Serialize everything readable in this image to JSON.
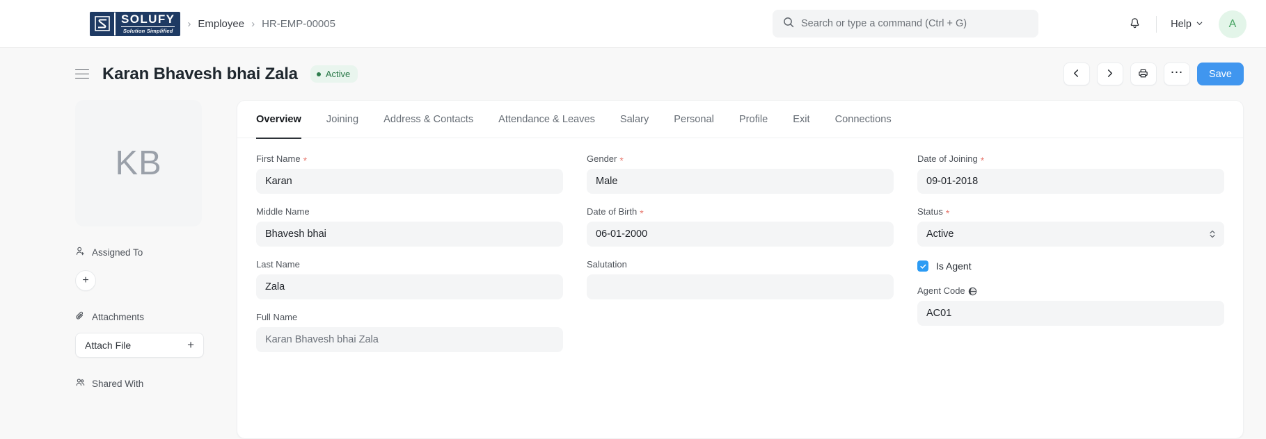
{
  "navbar": {
    "logo": {
      "word": "SOLUFY",
      "tagline": "Solution Simplified",
      "mark": "s-monogram-icon"
    },
    "breadcrumb": {
      "separator": "›",
      "parent": "Employee",
      "current": "HR-EMP-00005"
    },
    "search": {
      "placeholder": "Search or type a command (Ctrl + G)",
      "value": "",
      "icon": "search-icon"
    },
    "notifications_icon": "bell-icon",
    "help_label": "Help",
    "help_chevron": "chevron-down-icon",
    "avatar_initial": "A"
  },
  "title_row": {
    "menu_icon": "hamburger-icon",
    "title": "Karan Bhavesh bhai Zala",
    "status_badge": "Active",
    "actions": {
      "prev": "chevron-left-icon",
      "next": "chevron-right-icon",
      "print": "printer-icon",
      "more": "ellipsis-icon",
      "save_label": "Save"
    }
  },
  "sidebar": {
    "avatar_initials": "KB",
    "assigned_to": {
      "label": "Assigned To",
      "icon": "user-plus-icon",
      "add_label": "+"
    },
    "attachments": {
      "label": "Attachments",
      "icon": "paperclip-icon",
      "button_label": "Attach File",
      "button_icon": "plus-icon"
    },
    "shared_with": {
      "label": "Shared With",
      "icon": "users-icon"
    }
  },
  "tabs": [
    {
      "label": "Overview",
      "active": true
    },
    {
      "label": "Joining",
      "active": false
    },
    {
      "label": "Address & Contacts",
      "active": false
    },
    {
      "label": "Attendance & Leaves",
      "active": false
    },
    {
      "label": "Salary",
      "active": false
    },
    {
      "label": "Personal",
      "active": false
    },
    {
      "label": "Profile",
      "active": false
    },
    {
      "label": "Exit",
      "active": false
    },
    {
      "label": "Connections",
      "active": false
    }
  ],
  "form": {
    "col1": {
      "first_name": {
        "label": "First Name",
        "required": true,
        "value": "Karan"
      },
      "middle_name": {
        "label": "Middle Name",
        "required": false,
        "value": "Bhavesh bhai"
      },
      "last_name": {
        "label": "Last Name",
        "required": false,
        "value": "Zala"
      },
      "full_name": {
        "label": "Full Name",
        "required": false,
        "value": "Karan Bhavesh bhai Zala"
      }
    },
    "col2": {
      "gender": {
        "label": "Gender",
        "required": true,
        "value": "Male"
      },
      "dob": {
        "label": "Date of Birth",
        "required": true,
        "value": "06-01-2000"
      },
      "salutation": {
        "label": "Salutation",
        "required": false,
        "value": ""
      }
    },
    "col3": {
      "doj": {
        "label": "Date of Joining",
        "required": true,
        "value": "09-01-2018"
      },
      "status": {
        "label": "Status",
        "required": true,
        "value": "Active"
      },
      "is_agent": {
        "label": "Is Agent",
        "checked": true
      },
      "agent_code": {
        "label": "Agent Code",
        "value": "AC01",
        "icon": "globe-icon"
      }
    }
  },
  "colors": {
    "accent": "#4096ef",
    "status_green_text": "#2a7848",
    "status_green_bg": "#e9f5ee",
    "required_red": "#e8796f",
    "logo_navy": "#1e3a63",
    "field_bg": "#f4f5f6",
    "page_bg": "#f8f8f8"
  }
}
